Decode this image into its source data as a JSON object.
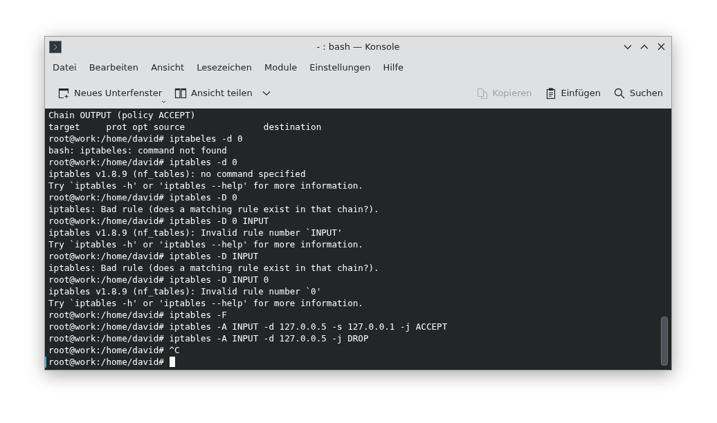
{
  "window": {
    "title": "- : bash — Konsole"
  },
  "menu": [
    "Datei",
    "Bearbeiten",
    "Ansicht",
    "Lesezeichen",
    "Module",
    "Einstellungen",
    "Hilfe"
  ],
  "toolbar": {
    "left": [
      {
        "kind": "new-tab",
        "label": "Neues Unterfenster",
        "disabled": false
      },
      {
        "kind": "split",
        "label": "Ansicht teilen",
        "disabled": false
      }
    ],
    "right": [
      {
        "kind": "copy",
        "label": "Kopieren",
        "disabled": true
      },
      {
        "kind": "paste",
        "label": "Einfügen",
        "disabled": false
      },
      {
        "kind": "search",
        "label": "Suchen",
        "disabled": false
      }
    ]
  },
  "terminal": {
    "cursor": true,
    "lines": [
      "Chain OUTPUT (policy ACCEPT)",
      "target     prot opt source               destination",
      "root@work:/home/david# iptabeles -d 0",
      "bash: iptabeles: command not found",
      "root@work:/home/david# iptables -d 0",
      "iptables v1.8.9 (nf_tables): no command specified",
      "Try `iptables -h' or 'iptables --help' for more information.",
      "root@work:/home/david# iptables -D 0",
      "iptables: Bad rule (does a matching rule exist in that chain?).",
      "root@work:/home/david# iptables -D 0 INPUT",
      "iptables v1.8.9 (nf_tables): Invalid rule number `INPUT'",
      "Try `iptables -h' or 'iptables --help' for more information.",
      "root@work:/home/david# iptables -D INPUT",
      "iptables: Bad rule (does a matching rule exist in that chain?).",
      "root@work:/home/david# iptables -D INPUT 0",
      "iptables v1.8.9 (nf_tables): Invalid rule number `0'",
      "Try `iptables -h' or 'iptables --help' for more information.",
      "root@work:/home/david# iptables -F",
      "root@work:/home/david# iptables -A INPUT -d 127.0.0.5 -s 127.0.0.1 -j ACCEPT",
      "root@work:/home/david# iptables -A INPUT -d 127.0.0.5 -j DROP",
      "root@work:/home/david# ^C",
      "root@work:/home/david#"
    ]
  }
}
